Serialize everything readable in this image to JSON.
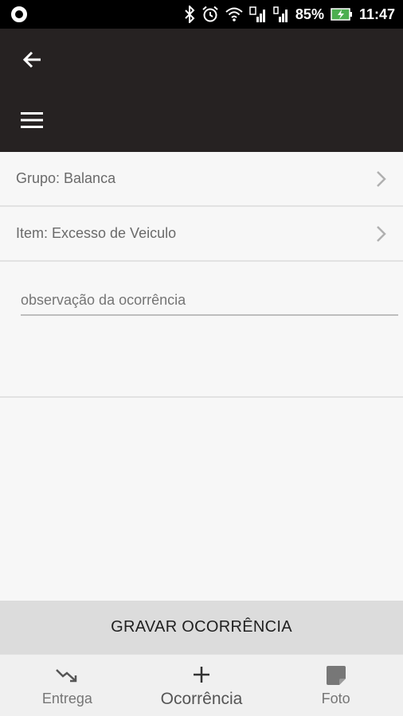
{
  "status_bar": {
    "battery": "85%",
    "time": "11:47"
  },
  "icons": {
    "back": "arrow-left-icon",
    "menu": "hamburger-menu-icon",
    "chevron": "chevron-right-icon",
    "entrega": "trending-down-icon",
    "ocorrencia": "plus-icon",
    "foto": "photo-icon"
  },
  "colors": {
    "appbar": "#262222",
    "status_bar": "#000000",
    "background": "#f7f7f7",
    "save_button": "#dcdcdc"
  },
  "form": {
    "grupo_label": "Grupo: Balanca",
    "item_label": "Item: Excesso de Veiculo",
    "observacao_placeholder": "observação da ocorrência"
  },
  "save_button_label": "GRAVAR OCORRÊNCIA",
  "bottom_nav": {
    "items": [
      {
        "label": "Entrega"
      },
      {
        "label": "Ocorrência"
      },
      {
        "label": "Foto"
      }
    ]
  }
}
